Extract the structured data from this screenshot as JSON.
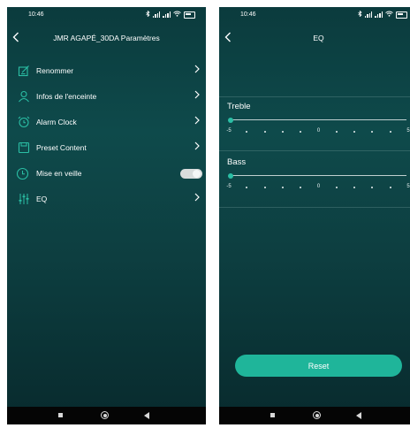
{
  "status_bar": {
    "time": "10:46"
  },
  "settings_screen": {
    "title": "JMR AGAPÉ_30DA Paramètres",
    "items": [
      {
        "label": "Renommer",
        "icon": "edit-icon",
        "control": "chevron"
      },
      {
        "label": "Infos de l'enceinte",
        "icon": "person-icon",
        "control": "chevron"
      },
      {
        "label": "Alarm Clock",
        "icon": "alarm-clock-icon",
        "control": "chevron"
      },
      {
        "label": "Preset Content",
        "icon": "save-icon",
        "control": "chevron"
      },
      {
        "label": "Mise en veille",
        "icon": "sleep-clock-icon",
        "control": "toggle",
        "toggle_on": false
      },
      {
        "label": "EQ",
        "icon": "equalizer-icon",
        "control": "chevron"
      }
    ]
  },
  "eq_screen": {
    "title": "EQ",
    "sliders": [
      {
        "label": "Treble",
        "min": -5,
        "max": 5,
        "value": -5
      },
      {
        "label": "Bass",
        "min": -5,
        "max": 5,
        "value": -5
      }
    ],
    "tick_labels": {
      "min": "-5",
      "mid": "0",
      "max": "5"
    },
    "reset_label": "Reset"
  },
  "colors": {
    "accent": "#2bbfa5",
    "background": "#0e4a4b",
    "button": "#1fb59a"
  }
}
